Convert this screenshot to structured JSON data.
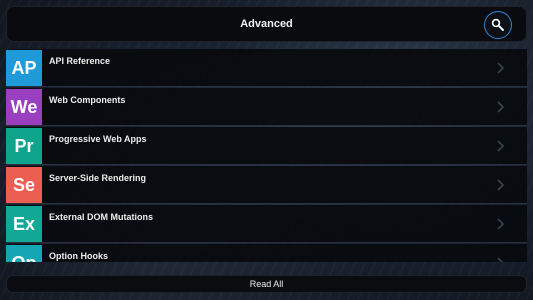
{
  "header": {
    "title": "Advanced",
    "search_icon": "search-icon"
  },
  "items": [
    {
      "abbr": "AP",
      "label": "API Reference",
      "color": "#1e9ad9"
    },
    {
      "abbr": "We",
      "label": "Web Components",
      "color": "#9a3fc0"
    },
    {
      "abbr": "Pr",
      "label": "Progressive Web Apps",
      "color": "#0fa58c"
    },
    {
      "abbr": "Se",
      "label": "Server-Side Rendering",
      "color": "#ec5d52"
    },
    {
      "abbr": "Ex",
      "label": "External DOM Mutations",
      "color": "#12a896"
    },
    {
      "abbr": "Op",
      "label": "Option Hooks",
      "color": "#14a6b4"
    }
  ],
  "footer": {
    "read_all_label": "Read All"
  },
  "colors": {
    "accent": "#2f86d6",
    "panel": "#090b0f"
  }
}
